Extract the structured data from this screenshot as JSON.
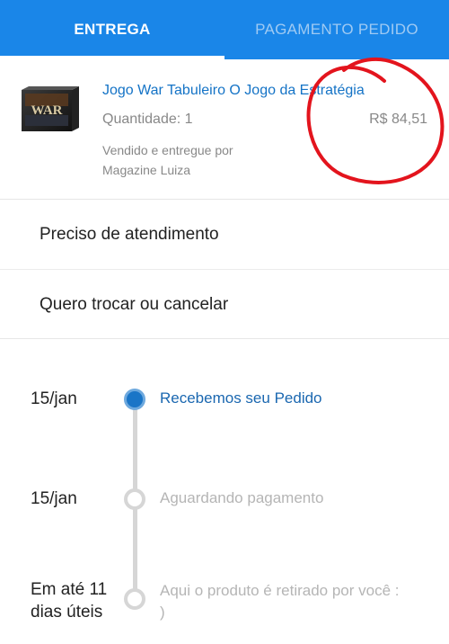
{
  "tabs": {
    "delivery": "ENTREGA",
    "payment": "PAGAMENTO PEDIDO"
  },
  "product": {
    "thumb_text": "WAR",
    "title": "Jogo War Tabuleiro O Jogo da Estratégia",
    "quantity": "Quantidade: 1",
    "price": "R$ 84,51",
    "seller_line1": "Vendido e entregue por",
    "seller_line2": "Magazine Luiza"
  },
  "menu": {
    "help": "Preciso de atendimento",
    "exchange": "Quero trocar ou cancelar"
  },
  "timeline": [
    {
      "date": "15/jan",
      "label": "Recebemos seu Pedido",
      "state": "active"
    },
    {
      "date": "15/jan",
      "label": "Aguardando pagamento",
      "state": "idle"
    },
    {
      "date_line1": "Em até 11",
      "date_line2": "dias úteis",
      "label": "Aqui o produto é retirado por você : )",
      "state": "idle"
    }
  ],
  "colors": {
    "header_blue": "#1a86e8",
    "link_blue": "#1473c6",
    "annotation_red": "#e3141d"
  }
}
